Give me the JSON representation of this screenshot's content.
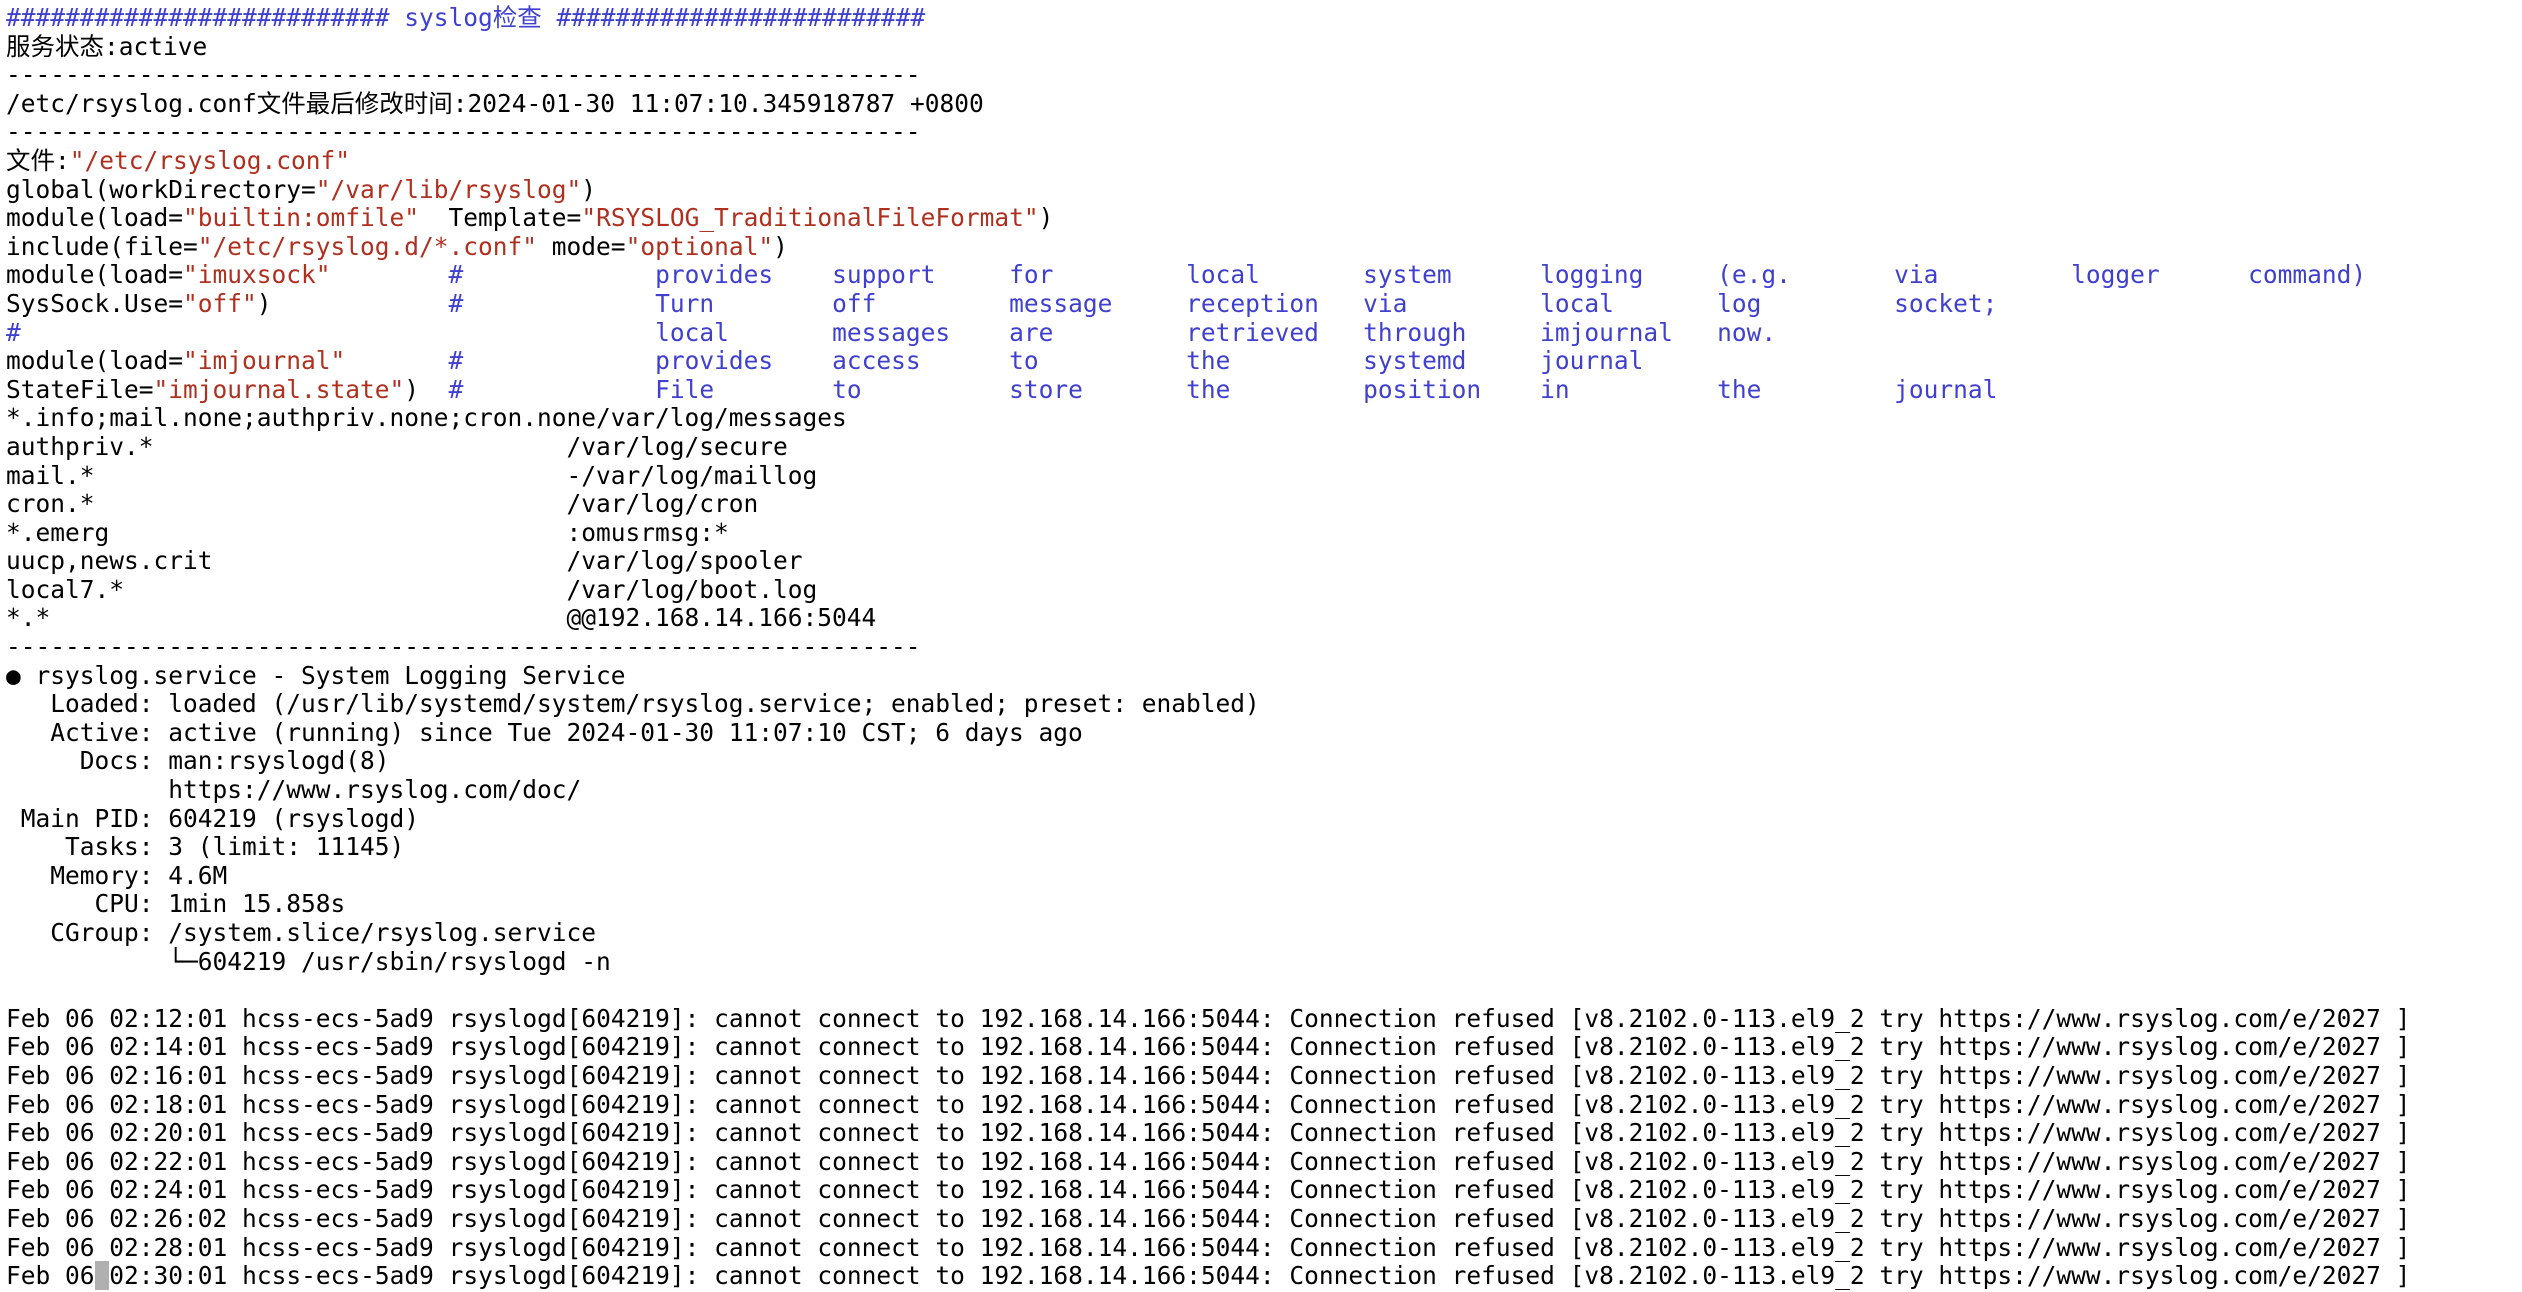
{
  "terminal": {
    "colors": {
      "background": "#ffffff",
      "foreground": "#000000",
      "blue": "#4040d0",
      "red": "#b03020",
      "cursor": "#b0b0b0"
    },
    "header": {
      "hash_left": "##########################",
      "title": " syslog检查 ",
      "hash_right": "#########################"
    },
    "service_state_line": "服务状态:active",
    "separator": "--------------------------------------------------------------",
    "mtime_line": "/etc/rsyslog.conf文件最后修改时间:2024-01-30 11:07:10.345918787 +0800",
    "file_label": "文件:",
    "file_path_quoted": "\"/etc/rsyslog.conf\"",
    "config_lines": [
      {
        "left_plain": "global(workDirectory=",
        "left_str": "\"/var/lib/rsyslog\"",
        "left_tail": ")",
        "right_plain": "",
        "right_str": "",
        "right_tail": ""
      },
      {
        "left_plain": "module(load=",
        "left_str": "\"builtin:omfile\"",
        "left_tail": "",
        "right_plain": "Template=",
        "right_str": "\"RSYSLOG_TraditionalFileFormat\"",
        "right_tail": ")"
      },
      {
        "left_plain": "include(file=",
        "left_str": "\"/etc/rsyslog.d/*.conf\"",
        "left_tail": "",
        "right_plain": "mode=",
        "right_str": "\"optional\"",
        "right_tail": ")"
      }
    ],
    "comment_rows": [
      {
        "left_plain": "module(load=",
        "left_str": "\"imuxsock\"",
        "left_tail": "",
        "hash": "#",
        "words": [
          "provides",
          "support",
          "for",
          "local",
          "system",
          "logging",
          "(e.g.",
          "via",
          "logger",
          "command)"
        ]
      },
      {
        "left_plain": "SysSock.Use=",
        "left_str": "\"off\"",
        "left_tail": ")",
        "hash": "#",
        "words": [
          "Turn",
          "off",
          "message",
          "reception",
          "via",
          "local",
          "log",
          "socket;"
        ]
      },
      {
        "left_plain": "",
        "left_str": "",
        "left_tail": "",
        "hash": "#",
        "left_hash": "#",
        "words": [
          "local",
          "messages",
          "are",
          "retrieved",
          "through",
          "imjournal",
          "now."
        ]
      },
      {
        "left_plain": "module(load=",
        "left_str": "\"imjournal\"",
        "left_tail": "",
        "hash": "#",
        "words": [
          "provides",
          "access",
          "to",
          "the",
          "systemd",
          "journal"
        ]
      },
      {
        "left_plain": "StateFile=",
        "left_str": "\"imjournal.state\"",
        "left_tail": ")",
        "hash": "#",
        "words": [
          "File",
          "to",
          "store",
          "the",
          "position",
          "in",
          "the",
          "journal"
        ]
      }
    ],
    "rules": [
      {
        "selector": "*.info;mail.none;authpriv.none;cron.none",
        "target": "/var/log/messages"
      },
      {
        "selector": "authpriv.*",
        "target": "/var/log/secure"
      },
      {
        "selector": "mail.*",
        "target": "-/var/log/maillog"
      },
      {
        "selector": "cron.*",
        "target": "/var/log/cron"
      },
      {
        "selector": "*.emerg",
        "target": ":omusrmsg:*"
      },
      {
        "selector": "uucp,news.crit",
        "target": "/var/log/spooler"
      },
      {
        "selector": "local7.*",
        "target": "/var/log/boot.log"
      },
      {
        "selector": "*.*",
        "target": "@@192.168.14.166:5044"
      }
    ],
    "status": {
      "bullet": "●",
      "unit_title": "rsyslog.service - System Logging Service",
      "rows": [
        {
          "label": "   Loaded:",
          "value": "loaded (/usr/lib/systemd/system/rsyslog.service; enabled; preset: enabled)"
        },
        {
          "label": "   Active:",
          "value": "active (running) since Tue 2024-01-30 11:07:10 CST; 6 days ago"
        },
        {
          "label": "     Docs:",
          "value": "man:rsyslogd(8)"
        },
        {
          "label": "          ",
          "value": "https://www.rsyslog.com/doc/"
        },
        {
          "label": " Main PID:",
          "value": "604219 (rsyslogd)"
        },
        {
          "label": "    Tasks:",
          "value": "3 (limit: 11145)"
        },
        {
          "label": "   Memory:",
          "value": "4.6M"
        },
        {
          "label": "      CPU:",
          "value": "1min 15.858s"
        },
        {
          "label": "   CGroup:",
          "value": "/system.slice/rsyslog.service"
        },
        {
          "label": "          ",
          "value": "└─604219 /usr/sbin/rsyslogd -n"
        }
      ]
    },
    "logs": {
      "host": "hcss-ecs-5ad9",
      "process": "rsyslogd[604219]",
      "message": "cannot connect to 192.168.14.166:5044: Connection refused [v8.2102.0-113.el9_2 try https://www.rsyslog.com/e/2027 ]",
      "entries": [
        {
          "timestamp": "Feb 06 02:12:01",
          "cursor": false
        },
        {
          "timestamp": "Feb 06 02:14:01",
          "cursor": false
        },
        {
          "timestamp": "Feb 06 02:16:01",
          "cursor": false
        },
        {
          "timestamp": "Feb 06 02:18:01",
          "cursor": false
        },
        {
          "timestamp": "Feb 06 02:20:01",
          "cursor": false
        },
        {
          "timestamp": "Feb 06 02:22:01",
          "cursor": false
        },
        {
          "timestamp": "Feb 06 02:24:01",
          "cursor": false
        },
        {
          "timestamp": "Feb 06 02:26:02",
          "cursor": false
        },
        {
          "timestamp": "Feb 06 02:28:01",
          "cursor": false
        },
        {
          "timestamp": "Feb 06 02:30:01",
          "cursor": true
        }
      ]
    }
  }
}
